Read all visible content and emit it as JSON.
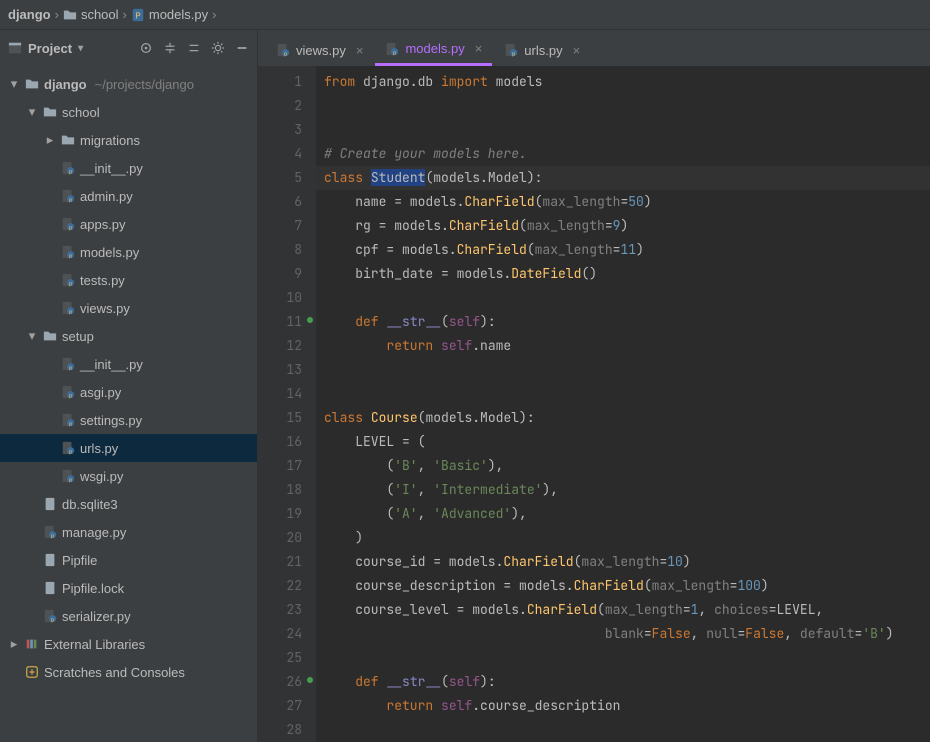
{
  "breadcrumb": {
    "items": [
      "django",
      "school",
      "models.py"
    ]
  },
  "sidebar": {
    "title": "Project",
    "root": {
      "label": "django",
      "aux": "~/projects/django"
    },
    "school": {
      "label": "school"
    },
    "migrations": {
      "label": "migrations"
    },
    "files_school": [
      "__init__.py",
      "admin.py",
      "apps.py",
      "models.py",
      "tests.py",
      "views.py"
    ],
    "setup": {
      "label": "setup"
    },
    "files_setup": [
      "__init__.py",
      "asgi.py",
      "settings.py",
      "urls.py",
      "wsgi.py"
    ],
    "files_root": [
      "db.sqlite3",
      "manage.py",
      "Pipfile",
      "Pipfile.lock",
      "serializer.py"
    ],
    "ext_lib": "External Libraries",
    "scratches": "Scratches and Consoles"
  },
  "tabs": {
    "items": [
      "views.py",
      "models.py",
      "urls.py"
    ],
    "active_index": 1
  },
  "code": {
    "lines": [
      {
        "n": 1,
        "html": "<span class='kw'>from</span> django.db <span class='kw'>import</span> models"
      },
      {
        "n": 2,
        "html": ""
      },
      {
        "n": 3,
        "html": ""
      },
      {
        "n": 4,
        "html": "<span class='cm'># Create your models here.</span>"
      },
      {
        "n": 5,
        "html": "<span class='kw'>class</span> <span class='hlclass'>Student</span>(models.Model):",
        "hl": true
      },
      {
        "n": 6,
        "html": "    name = models.<span class='fn'>CharField</span>(<span class='param'>max_length</span>=<span class='num'>50</span>)"
      },
      {
        "n": 7,
        "html": "    rg = models.<span class='fn'>CharField</span>(<span class='param'>max_length</span>=<span class='num'>9</span>)"
      },
      {
        "n": 8,
        "html": "    cpf = models.<span class='fn'>CharField</span>(<span class='param'>max_length</span>=<span class='num'>11</span>)"
      },
      {
        "n": 9,
        "html": "    birth_date = models.<span class='fn'>DateField</span>()"
      },
      {
        "n": 10,
        "html": ""
      },
      {
        "n": 11,
        "html": "    <span class='kw'>def</span> <span class='builtin'>__str__</span>(<span class='self'>self</span>):",
        "override": true
      },
      {
        "n": 12,
        "html": "        <span class='kw'>return</span> <span class='self'>self</span>.name"
      },
      {
        "n": 13,
        "html": ""
      },
      {
        "n": 14,
        "html": ""
      },
      {
        "n": 15,
        "html": "<span class='kw'>class</span> <span class='fn'>Course</span>(models.Model):"
      },
      {
        "n": 16,
        "html": "    LEVEL = ("
      },
      {
        "n": 17,
        "html": "        (<span class='str'>'B'</span>, <span class='str'>'Basic'</span>),"
      },
      {
        "n": 18,
        "html": "        (<span class='str'>'I'</span>, <span class='str'>'Intermediate'</span>),"
      },
      {
        "n": 19,
        "html": "        (<span class='str'>'A'</span>, <span class='str'>'Advanced'</span>),"
      },
      {
        "n": 20,
        "html": "    )"
      },
      {
        "n": 21,
        "html": "    course_id = models.<span class='fn'>CharField</span>(<span class='param'>max_length</span>=<span class='num'>10</span>)"
      },
      {
        "n": 22,
        "html": "    course_description = models.<span class='fn'>CharField</span>(<span class='param'>max_length</span>=<span class='num'>100</span>)"
      },
      {
        "n": 23,
        "html": "    course_level = models.<span class='fn'>CharField</span>(<span class='param'>max_length</span>=<span class='num'>1</span>, <span class='param'>choices</span>=LEVEL,"
      },
      {
        "n": 24,
        "html": "                                    <span class='param'>blank</span>=<span class='kw'>False</span>, <span class='param'>null</span>=<span class='kw'>False</span>, <span class='param'>default</span>=<span class='str'>'B'</span>)"
      },
      {
        "n": 25,
        "html": ""
      },
      {
        "n": 26,
        "html": "    <span class='kw'>def</span> <span class='builtin'>__str__</span>(<span class='self'>self</span>):",
        "override": true
      },
      {
        "n": 27,
        "html": "        <span class='kw'>return</span> <span class='self'>self</span>.course_description"
      },
      {
        "n": 28,
        "html": ""
      }
    ]
  }
}
